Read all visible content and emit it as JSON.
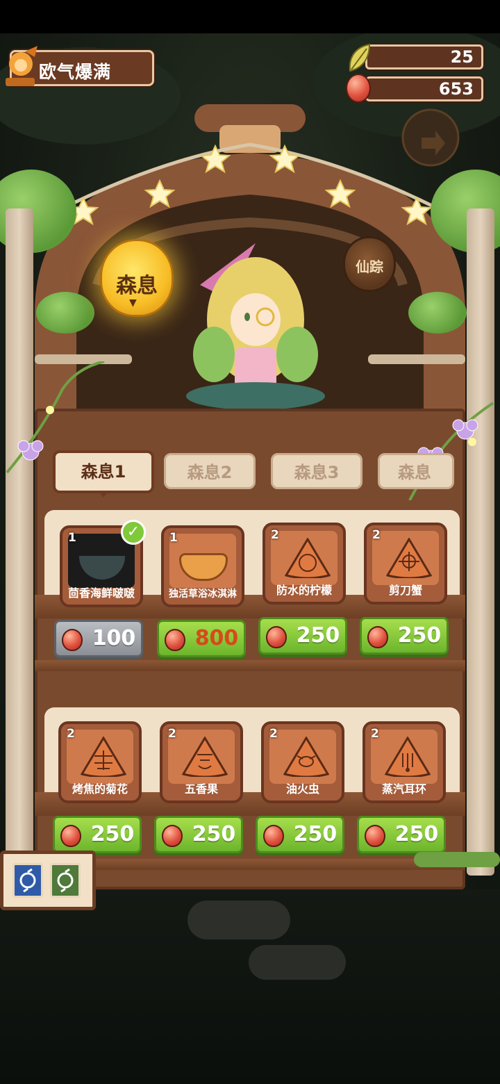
{
  "player": {
    "title": "欧气爆满"
  },
  "currency": {
    "leaf": "25",
    "beans": "653"
  },
  "lamps": {
    "active": "森息",
    "inactive": "仙踪"
  },
  "tabs": [
    {
      "label": "森息1",
      "active": true
    },
    {
      "label": "森息2",
      "active": false
    },
    {
      "label": "森息3",
      "active": false
    },
    {
      "label": "森息",
      "active": false
    }
  ],
  "items": [
    {
      "count": "1",
      "name": "茴香海鲜啵啵",
      "price": "100",
      "style": "gray",
      "owned": true
    },
    {
      "count": "1",
      "name": "独活草浴冰淇淋",
      "price": "800",
      "style": "red",
      "owned": false
    },
    {
      "count": "2",
      "name": "防水的柠檬",
      "price": "250",
      "style": "green",
      "owned": false
    },
    {
      "count": "2",
      "name": "剪刀蟹",
      "price": "250",
      "style": "green",
      "owned": false
    },
    {
      "count": "2",
      "name": "烤焦的菊花",
      "price": "250",
      "style": "green",
      "owned": false
    },
    {
      "count": "2",
      "name": "五香果",
      "price": "250",
      "style": "green",
      "owned": false
    },
    {
      "count": "2",
      "name": "油火虫",
      "price": "250",
      "style": "green",
      "owned": false
    },
    {
      "count": "2",
      "name": "蒸汽耳环",
      "price": "250",
      "style": "green",
      "owned": false
    }
  ],
  "colors": {
    "accent_green": "#7cc23a",
    "wood": "#7a4a2e",
    "gold": "#f7bc25",
    "bean": "#e0523f"
  }
}
